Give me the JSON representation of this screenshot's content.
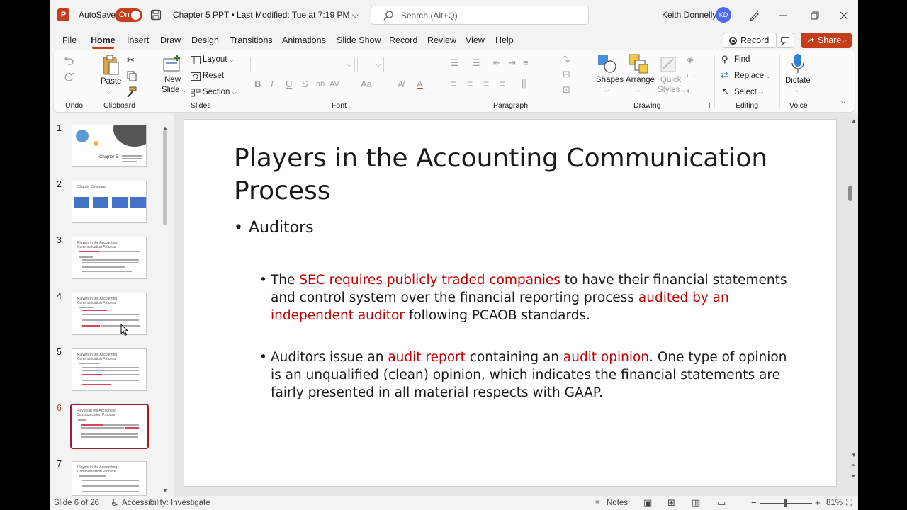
{
  "titlebar": {
    "app_logo": "P",
    "autosave_label": "AutoSave",
    "autosave_state": "On",
    "document_title": "Chapter 5 PPT • Last Modified: Tue at 7:19 PM",
    "search_placeholder": "Search (Alt+Q)",
    "user_name": "Keith Donnelly",
    "user_initials": "KD"
  },
  "menu": {
    "tabs": [
      "File",
      "Home",
      "Insert",
      "Draw",
      "Design",
      "Transitions",
      "Animations",
      "Slide Show",
      "Record",
      "Review",
      "View",
      "Help"
    ],
    "active_tab": "Home",
    "record_label": "Record",
    "share_label": "Share"
  },
  "ribbon": {
    "groups": {
      "undo": "Undo",
      "clipboard": "Clipboard",
      "slides": "Slides",
      "font": "Font",
      "paragraph": "Paragraph",
      "drawing": "Drawing",
      "editing": "Editing",
      "voice": "Voice"
    },
    "paste": "Paste",
    "new_slide_1": "New",
    "new_slide_2": "Slide",
    "layout": "Layout",
    "reset": "Reset",
    "section": "Section",
    "shapes": "Shapes",
    "arrange": "Arrange",
    "quick_styles_1": "Quick",
    "quick_styles_2": "Styles",
    "find": "Find",
    "replace": "Replace",
    "select": "Select",
    "dictate": "Dictate",
    "font_buttons": {
      "bold": "B",
      "italic": "I",
      "underline": "U",
      "strike": "S",
      "case": "Aa",
      "color": "A"
    }
  },
  "thumbnails": [
    {
      "num": "1",
      "title": "Chapter 5"
    },
    {
      "num": "2",
      "title": "Chapter Overview"
    },
    {
      "num": "3",
      "title": "Players in the Accounting Communication Process"
    },
    {
      "num": "4",
      "title": "Players in the Accounting Communication Process"
    },
    {
      "num": "5",
      "title": "Players in the Accounting Communication Process"
    },
    {
      "num": "6",
      "title": "Players in the Accounting Communication Process"
    },
    {
      "num": "7",
      "title": "Players in the Accounting Communication Process"
    }
  ],
  "slide": {
    "title": "Players in the Accounting Communication Process",
    "bullet1": "Auditors",
    "para1": {
      "t1": "The ",
      "r1": "SEC requires publicly traded companies",
      "t2": " to have their financial statements and control system over the financial reporting process ",
      "r2": "audited by an independent auditor",
      "t3": " following PCAOB standards."
    },
    "para2": {
      "t1": "Auditors issue an ",
      "r1": "audit report",
      "t2": " containing an ",
      "r2": "audit opinion",
      "t3": ". One type of opinion is an unqualified (clean) opinion, which indicates the financial statements are fairly presented in all material respects with GAAP."
    }
  },
  "status": {
    "slide_of": "Slide 6 of 26",
    "accessibility": "Accessibility: Investigate",
    "notes": "Notes",
    "zoom": "81%",
    "zoom_minus": "−",
    "zoom_plus": "+"
  },
  "colors": {
    "accent": "#c43e1c",
    "emphasis_red": "#c00000",
    "active_thumb_border": "#9f1d2a",
    "avatar": "#4f6bed"
  }
}
